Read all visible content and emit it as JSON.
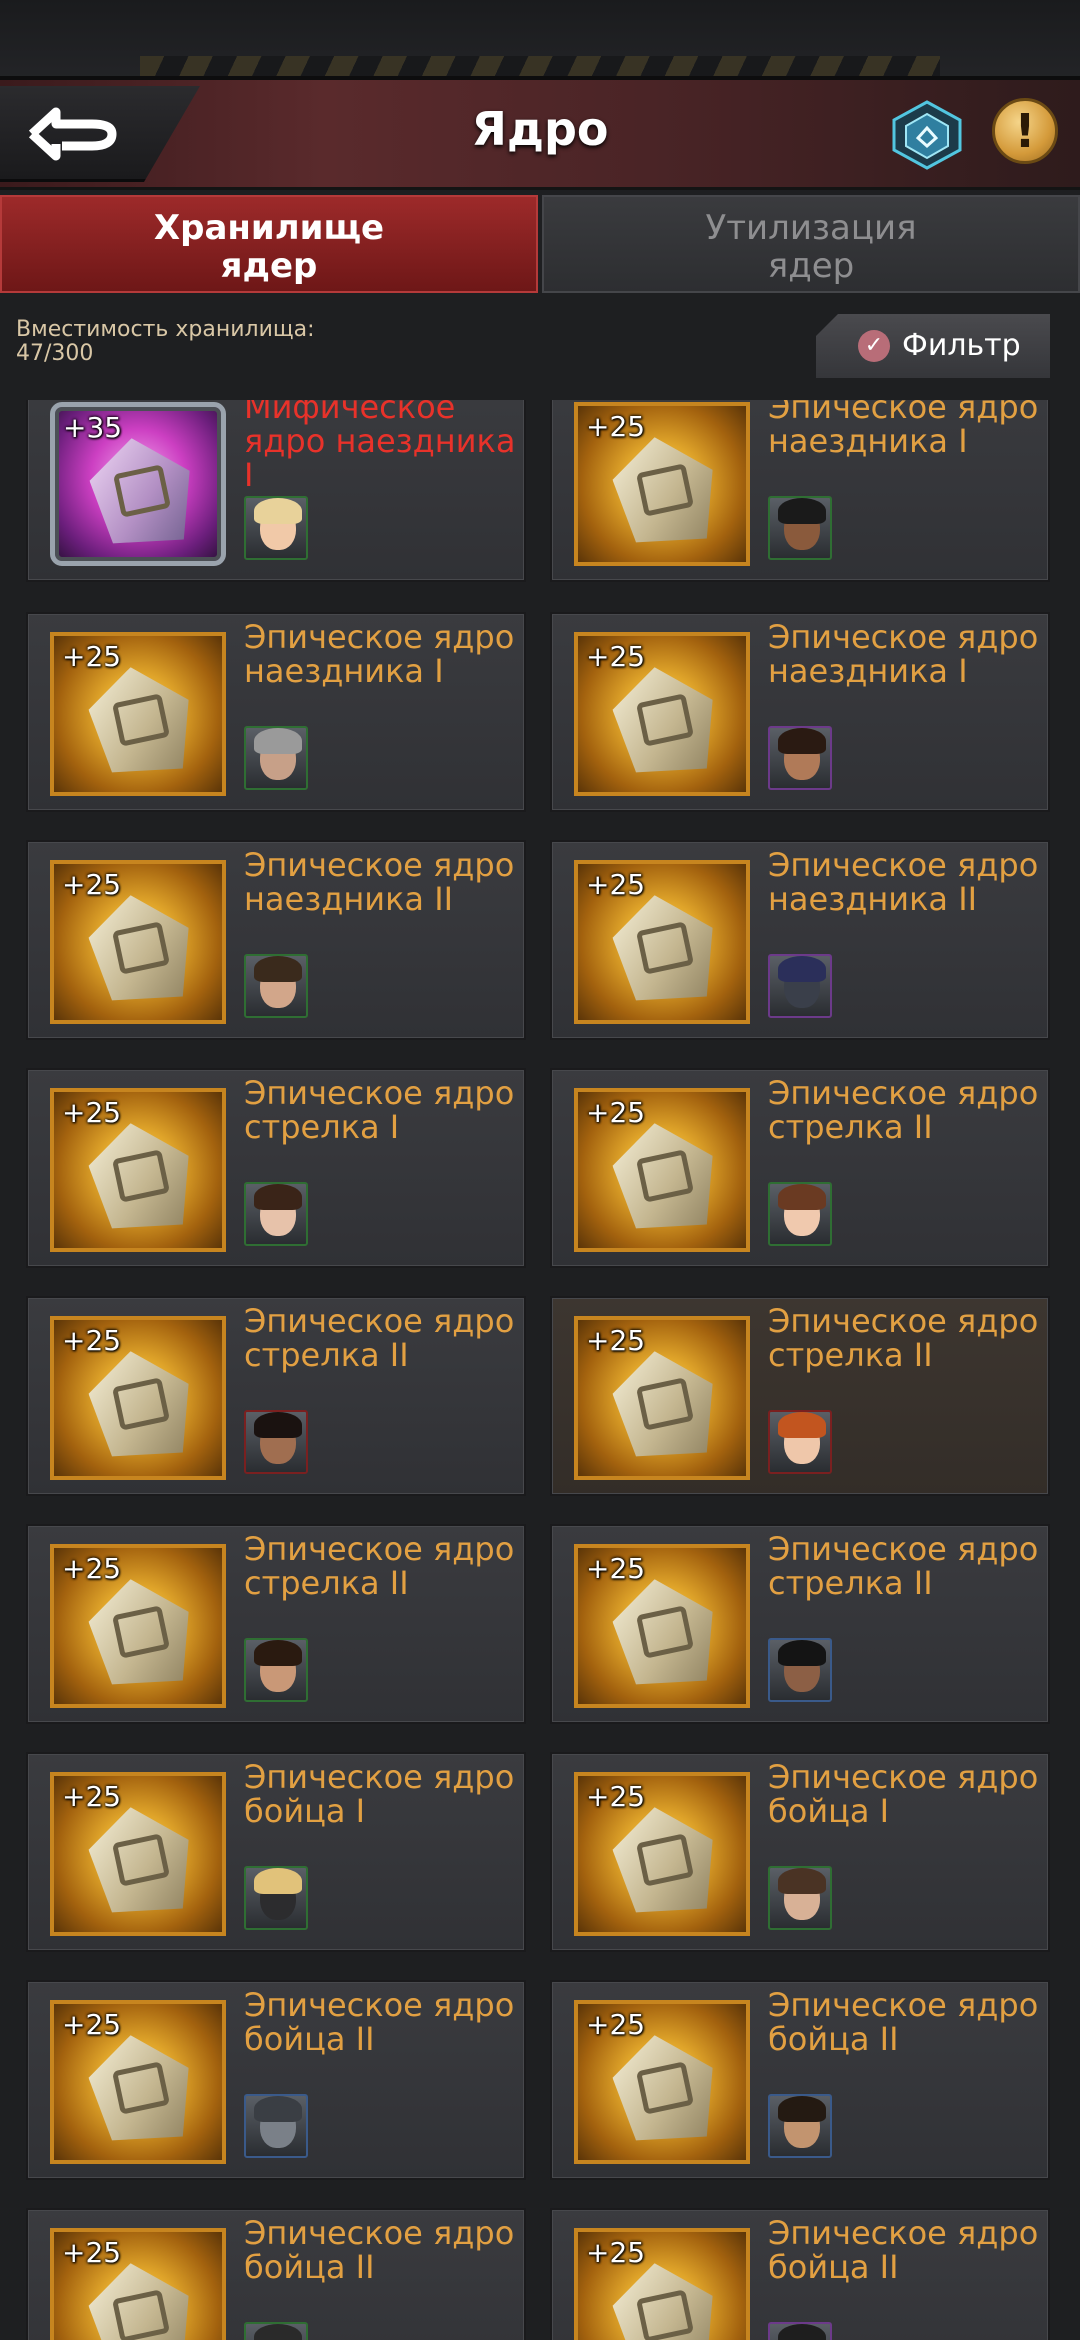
{
  "header": {
    "title": "Ядро"
  },
  "tabs": [
    {
      "line1": "Хранилище",
      "line2": "ядер",
      "active": true
    },
    {
      "line1": "Утилизация",
      "line2": "ядер",
      "active": false
    }
  ],
  "storage": {
    "label": "Вместимость хранилища:",
    "value": "47/300"
  },
  "filter": {
    "label": "Фильтр"
  },
  "items": [
    {
      "level": "+35",
      "name": "Мифическое ядро наездника I",
      "rarity": "mythic"
    },
    {
      "level": "+25",
      "name": "Эпическое ядро наездника I",
      "rarity": "epic"
    },
    {
      "level": "+25",
      "name": "Эпическое ядро наездника I",
      "rarity": "epic"
    },
    {
      "level": "+25",
      "name": "Эпическое ядро наездника I",
      "rarity": "epic"
    },
    {
      "level": "+25",
      "name": "Эпическое ядро наездника II",
      "rarity": "epic"
    },
    {
      "level": "+25",
      "name": "Эпическое ядро наездника II",
      "rarity": "epic"
    },
    {
      "level": "+25",
      "name": "Эпическое ядро стрелка I",
      "rarity": "epic"
    },
    {
      "level": "+25",
      "name": "Эпическое ядро стрелка II",
      "rarity": "epic"
    },
    {
      "level": "+25",
      "name": "Эпическое ядро стрелка II",
      "rarity": "epic"
    },
    {
      "level": "+25",
      "name": "Эпическое ядро стрелка II",
      "rarity": "epic"
    },
    {
      "level": "+25",
      "name": "Эпическое ядро стрелка II",
      "rarity": "epic"
    },
    {
      "level": "+25",
      "name": "Эпическое ядро стрелка II",
      "rarity": "epic"
    },
    {
      "level": "+25",
      "name": "Эпическое ядро бойца I",
      "rarity": "epic"
    },
    {
      "level": "+25",
      "name": "Эпическое ядро бойца I",
      "rarity": "epic"
    },
    {
      "level": "+25",
      "name": "Эпическое ядро бойца II",
      "rarity": "epic"
    },
    {
      "level": "+25",
      "name": "Эпическое ядро бойца II",
      "rarity": "epic"
    },
    {
      "level": "+25",
      "name": "Эпическое ядро бойца II",
      "rarity": "epic"
    },
    {
      "level": "+25",
      "name": "Эпическое ядро бойца II",
      "rarity": "epic"
    }
  ],
  "colors": {
    "active_tab": "#8a2323",
    "epic_text": "#e2a042",
    "mythic_text": "#e8322a"
  }
}
